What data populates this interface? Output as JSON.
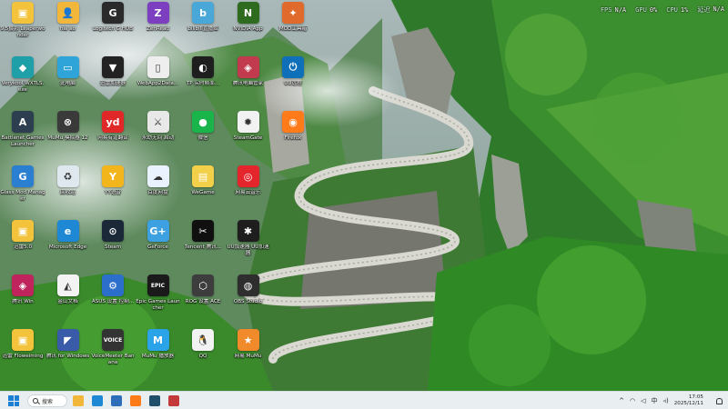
{
  "perf_overlay": [
    {
      "k": "FPS",
      "v": "N/A"
    },
    {
      "k": "GPU",
      "v": "0%"
    },
    {
      "k": "CPU",
      "v": "1%"
    },
    {
      "k": "延迟",
      "v": "N/A"
    }
  ],
  "desktop_icons": [
    {
      "col": 0,
      "row": 0,
      "label": "9.5摄影 Leaperwonder",
      "bg": "#f4c33c",
      "glyph": "▣",
      "icon": "folder-icon"
    },
    {
      "col": 1,
      "row": 0,
      "label": "hai ao",
      "bg": "#f2b63a",
      "glyph": "👤",
      "icon": "user-folder-icon"
    },
    {
      "col": 2,
      "row": 0,
      "label": "Logitech G HUB",
      "bg": "#2a2a2a",
      "glyph": "G",
      "icon": "logitech-icon"
    },
    {
      "col": 3,
      "row": 0,
      "label": "ZenRead",
      "bg": "#7b3fbf",
      "glyph": "Z",
      "icon": "zenread-icon"
    },
    {
      "col": 4,
      "row": 0,
      "label": "bilibili直播姬",
      "bg": "#4aa8d8",
      "glyph": "b",
      "icon": "bilibili-icon"
    },
    {
      "col": 5,
      "row": 0,
      "label": "NVIDIA App",
      "bg": "#2f6b1e",
      "glyph": "N",
      "icon": "nvidia-icon"
    },
    {
      "col": 6,
      "row": 0,
      "label": "MOD工具箱",
      "bg": "#e06a2c",
      "glyph": "✦",
      "icon": "mod-tool-icon"
    },
    {
      "col": 0,
      "row": 1,
      "label": "Verykool WXTLS.exe",
      "bg": "#1f9fa8",
      "glyph": "◆",
      "icon": "app-diamond-icon"
    },
    {
      "col": 1,
      "row": 1,
      "label": "此电脑",
      "bg": "#2fa4d8",
      "glyph": "▭",
      "icon": "this-pc-icon"
    },
    {
      "col": 2,
      "row": 1,
      "label": "迅雷加速器",
      "bg": "#222222",
      "glyph": "▼",
      "icon": "thunder-icon"
    },
    {
      "col": 3,
      "row": 1,
      "label": "WebApp2Data...",
      "bg": "#eeeeee",
      "glyph": "▯",
      "icon": "file-icon"
    },
    {
      "col": 4,
      "row": 1,
      "label": "TP 实时帧率...",
      "bg": "#1e1e1e",
      "glyph": "◐",
      "icon": "fps-tool-icon"
    },
    {
      "col": 5,
      "row": 1,
      "label": "腾讯电脑管家",
      "bg": "#c23a4e",
      "glyph": "◈",
      "icon": "pc-manager-icon"
    },
    {
      "col": 6,
      "row": 1,
      "label": "UU远程",
      "bg": "#0f6fb8",
      "glyph": "⏻",
      "icon": "uu-remote-icon"
    },
    {
      "col": 0,
      "row": 2,
      "label": "Battlenet Games Launcher",
      "bg": "#2c3e50",
      "glyph": "A",
      "icon": "battlenet-icon"
    },
    {
      "col": 1,
      "row": 2,
      "label": "MuMu 模拟器 12",
      "bg": "#3a3a3a",
      "glyph": "⊗",
      "icon": "mumu-icon"
    },
    {
      "col": 2,
      "row": 2,
      "label": "网易有道翻译",
      "bg": "#e02828",
      "glyph": "yd",
      "icon": "youdao-icon"
    },
    {
      "col": 3,
      "row": 2,
      "label": "永劫无间 启动",
      "bg": "#e8e8e8",
      "glyph": "⚔",
      "icon": "game-icon"
    },
    {
      "col": 4,
      "row": 2,
      "label": "微信",
      "bg": "#19b44a",
      "glyph": "●",
      "icon": "wechat-icon"
    },
    {
      "col": 5,
      "row": 2,
      "label": "SteamGate",
      "bg": "#f2f2f2",
      "glyph": "✹",
      "icon": "gear-icon"
    },
    {
      "col": 6,
      "row": 2,
      "label": "Firefox",
      "bg": "#ff7a18",
      "glyph": "◉",
      "icon": "firefox-icon"
    },
    {
      "col": 0,
      "row": 3,
      "label": "Glass Mod Manager",
      "bg": "#2a7fd0",
      "glyph": "G",
      "icon": "mod-manager-icon"
    },
    {
      "col": 1,
      "row": 3,
      "label": "回收站",
      "bg": "#dfe7ef",
      "glyph": "♻",
      "icon": "recycle-bin-icon"
    },
    {
      "col": 2,
      "row": 3,
      "label": "YY语音",
      "bg": "#f2b51c",
      "glyph": "Y",
      "icon": "yy-icon"
    },
    {
      "col": 3,
      "row": 3,
      "label": "百度网盘",
      "bg": "#eaf2ff",
      "glyph": "☁",
      "icon": "baidu-pan-icon"
    },
    {
      "col": 4,
      "row": 3,
      "label": "WeGame",
      "bg": "#f2d04a",
      "glyph": "▤",
      "icon": "wegame-icon"
    },
    {
      "col": 5,
      "row": 3,
      "label": "网易云音乐",
      "bg": "#e4262c",
      "glyph": "◎",
      "icon": "netease-music-icon"
    },
    {
      "col": 0,
      "row": 4,
      "label": "迅雷5.0",
      "bg": "#f4c33c",
      "glyph": "▣",
      "icon": "folder-icon"
    },
    {
      "col": 1,
      "row": 4,
      "label": "Microsoft Edge",
      "bg": "#1e88d4",
      "glyph": "e",
      "icon": "edge-icon"
    },
    {
      "col": 2,
      "row": 4,
      "label": "Steam",
      "bg": "#1b2838",
      "glyph": "⊙",
      "icon": "steam-icon"
    },
    {
      "col": 3,
      "row": 4,
      "label": "GeForce",
      "bg": "#3da0e0",
      "glyph": "G+",
      "icon": "geforce-icon"
    },
    {
      "col": 4,
      "row": 4,
      "label": "Tencent 腾讯...",
      "bg": "#101010",
      "glyph": "✂",
      "icon": "tencent-icon"
    },
    {
      "col": 5,
      "row": 4,
      "label": "UU加速器 UU加速器",
      "bg": "#1e1e1e",
      "glyph": "✱",
      "icon": "uu-booster-icon"
    },
    {
      "col": 0,
      "row": 5,
      "label": "腾讯 Win",
      "bg": "#c0245c",
      "glyph": "◈",
      "icon": "tencent-win-icon"
    },
    {
      "col": 1,
      "row": 5,
      "label": "金山文档",
      "bg": "#f3f3f3",
      "glyph": "◭",
      "icon": "kdocs-icon"
    },
    {
      "col": 2,
      "row": 5,
      "label": "ASUS 设置 控制...",
      "bg": "#2b6fcb",
      "glyph": "⚙",
      "icon": "settings-gear-icon"
    },
    {
      "col": 3,
      "row": 5,
      "label": "Epic Games Launcher",
      "bg": "#1a1a1a",
      "glyph": "EPIC",
      "icon": "epic-games-icon"
    },
    {
      "col": 4,
      "row": 5,
      "label": "ROG 设置 ACE",
      "bg": "#3d3d3d",
      "glyph": "⬡",
      "icon": "rog-icon"
    },
    {
      "col": 5,
      "row": 5,
      "label": "OBS Studio",
      "bg": "#2e2e2e",
      "glyph": "◍",
      "icon": "obs-icon"
    },
    {
      "col": 0,
      "row": 6,
      "label": "迅雷 Floweiming",
      "bg": "#f4c33c",
      "glyph": "▣",
      "icon": "folder-icon"
    },
    {
      "col": 1,
      "row": 6,
      "label": "腾讯 for Windows",
      "bg": "#3a5ba8",
      "glyph": "◤",
      "icon": "app-icon"
    },
    {
      "col": 2,
      "row": 6,
      "label": "VoiceMeeter Banana",
      "bg": "#333333",
      "glyph": "VOICE",
      "icon": "voicemeeter-icon"
    },
    {
      "col": 3,
      "row": 6,
      "label": "MuMu 播放器",
      "bg": "#2ba3e8",
      "glyph": "M",
      "icon": "mumu-player-icon"
    },
    {
      "col": 4,
      "row": 6,
      "label": "QQ",
      "bg": "#f2f2f2",
      "glyph": "🐧",
      "icon": "qq-icon"
    },
    {
      "col": 5,
      "row": 6,
      "label": "网易 MuMu",
      "bg": "#f08a2a",
      "glyph": "★",
      "icon": "game-star-icon"
    }
  ],
  "taskbar": {
    "search_label": "搜索",
    "apps": [
      {
        "name": "file-explorer-icon",
        "bg": "#f2b63a"
      },
      {
        "name": "edge-icon",
        "bg": "#1e88d4"
      },
      {
        "name": "store-icon",
        "bg": "#2c6fb8"
      },
      {
        "name": "firefox-icon",
        "bg": "#ff7a18"
      },
      {
        "name": "terminal-icon",
        "bg": "#1f4f6b"
      },
      {
        "name": "app-icon",
        "bg": "#c23a3a"
      }
    ],
    "tray_chevron": "^",
    "ime_label": "中",
    "time": "17:05",
    "date": "2025/12/11"
  }
}
